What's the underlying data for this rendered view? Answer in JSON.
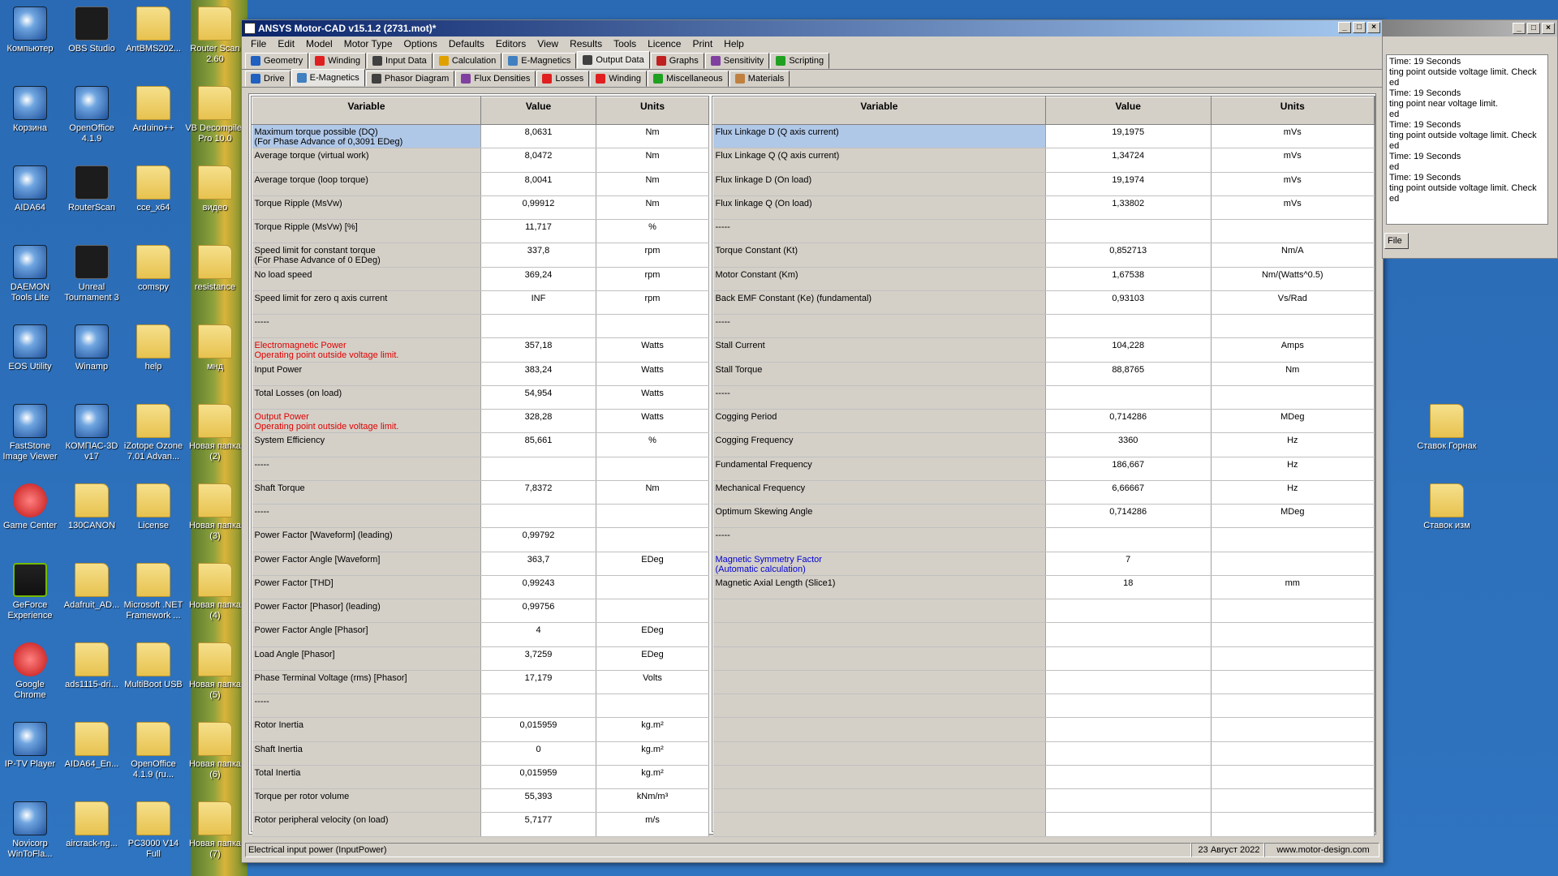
{
  "desktop": {
    "col1": [
      {
        "label": "Компьютер",
        "icon": "computer-icon"
      },
      {
        "label": "Корзина",
        "icon": "recycle-bin-icon"
      },
      {
        "label": "AIDA64",
        "icon": "aida64-icon"
      },
      {
        "label": "DAEMON Tools Lite",
        "icon": "daemon-tools-icon"
      },
      {
        "label": "EOS Utility",
        "icon": "eos-utility-icon"
      },
      {
        "label": "FastStone Image Viewer",
        "icon": "faststone-icon"
      },
      {
        "label": "Game Center",
        "icon": "game-center-icon"
      },
      {
        "label": "GeForce Experience",
        "icon": "geforce-icon"
      },
      {
        "label": "Google Chrome",
        "icon": "chrome-icon"
      },
      {
        "label": "IP-TV Player",
        "icon": "iptv-icon"
      },
      {
        "label": "Novicorp WinToFla...",
        "icon": "wintoflash-icon"
      }
    ],
    "col2": [
      {
        "label": "OBS Studio",
        "icon": "obs-icon"
      },
      {
        "label": "OpenOffice 4.1.9",
        "icon": "openoffice-icon"
      },
      {
        "label": "RouterScan",
        "icon": "routerscan-icon"
      },
      {
        "label": "Unreal Tournament 3",
        "icon": "unreal-icon"
      },
      {
        "label": "Winamp",
        "icon": "winamp-icon"
      },
      {
        "label": "КОМПАС-3D v17",
        "icon": "kompas-icon"
      },
      {
        "label": "130CANON",
        "icon": "folder-icon"
      },
      {
        "label": "Adafruit_AD...",
        "icon": "folder-icon"
      },
      {
        "label": "ads1115-dri...",
        "icon": "folder-icon"
      },
      {
        "label": "AIDA64_En...",
        "icon": "folder-icon"
      },
      {
        "label": "aircrack-ng...",
        "icon": "folder-icon"
      }
    ],
    "col3": [
      {
        "label": "AntBMS202...",
        "icon": "folder-icon"
      },
      {
        "label": "Arduino++",
        "icon": "folder-icon"
      },
      {
        "label": "cce_x64",
        "icon": "folder-icon"
      },
      {
        "label": "comspy",
        "icon": "folder-icon"
      },
      {
        "label": "help",
        "icon": "folder-icon"
      },
      {
        "label": "iZotope Ozone 7.01 Advan...",
        "icon": "folder-icon"
      },
      {
        "label": "License",
        "icon": "folder-icon"
      },
      {
        "label": "Microsoft .NET Framework ...",
        "icon": "folder-icon"
      },
      {
        "label": "MultiBoot USB",
        "icon": "folder-icon"
      },
      {
        "label": "OpenOffice 4.1.9 (ru...",
        "icon": "folder-icon"
      },
      {
        "label": "PC3000 V14 Full",
        "icon": "folder-icon"
      }
    ],
    "col4": [
      {
        "label": "Router Scan 2.60",
        "icon": "folder-icon"
      },
      {
        "label": "VB Decompiler Pro 10.0",
        "icon": "folder-icon"
      },
      {
        "label": "видео",
        "icon": "folder-icon"
      },
      {
        "label": "resistance",
        "icon": "folder-icon"
      },
      {
        "label": "мнд",
        "icon": "folder-icon"
      },
      {
        "label": "Новая папка (2)",
        "icon": "folder-icon"
      },
      {
        "label": "Новая папка (3)",
        "icon": "folder-icon"
      },
      {
        "label": "Новая папка (4)",
        "icon": "folder-icon"
      },
      {
        "label": "Новая папка (5)",
        "icon": "folder-icon"
      },
      {
        "label": "Новая папка (6)",
        "icon": "folder-icon"
      },
      {
        "label": "Новая папка (7)",
        "icon": "folder-icon"
      }
    ],
    "right": [
      {
        "label": "Ставок Горнак",
        "icon": "folder-icon"
      },
      {
        "label": "Ставок изм",
        "icon": "folder-icon"
      }
    ]
  },
  "window": {
    "title": "ANSYS Motor-CAD v15.1.2 (2731.mot)*",
    "menu": [
      "File",
      "Edit",
      "Model",
      "Motor Type",
      "Options",
      "Defaults",
      "Editors",
      "View",
      "Results",
      "Tools",
      "Licence",
      "Print",
      "Help"
    ],
    "tabs": [
      {
        "label": "Geometry",
        "color": "#2060c0"
      },
      {
        "label": "Winding",
        "color": "#e02020"
      },
      {
        "label": "Input Data",
        "color": "#404040"
      },
      {
        "label": "Calculation",
        "color": "#e0a000"
      },
      {
        "label": "E-Magnetics",
        "color": "#4080c0"
      },
      {
        "label": "Output Data",
        "color": "#404040"
      },
      {
        "label": "Graphs",
        "color": "#c02020"
      },
      {
        "label": "Sensitivity",
        "color": "#8040a0"
      },
      {
        "label": "Scripting",
        "color": "#20a020"
      }
    ],
    "subtabs": [
      {
        "label": "Drive",
        "color": "#2060c0"
      },
      {
        "label": "E-Magnetics",
        "color": "#4080c0"
      },
      {
        "label": "Phasor Diagram",
        "color": "#404040"
      },
      {
        "label": "Flux Densities",
        "color": "#8040a0"
      },
      {
        "label": "Losses",
        "color": "#e02020"
      },
      {
        "label": "Winding",
        "color": "#e02020"
      },
      {
        "label": "Miscellaneous",
        "color": "#20a020"
      },
      {
        "label": "Materials",
        "color": "#c08040"
      }
    ]
  },
  "headers": {
    "variable": "Variable",
    "value": "Value",
    "units": "Units"
  },
  "left_rows": [
    {
      "var": "Maximum torque possible (DQ)",
      "var2": "(For Phase Advance of 0,3091 EDeg)",
      "val": "8,0631",
      "unit": "Nm",
      "sel": true
    },
    {
      "var": "Average torque (virtual work)",
      "val": "8,0472",
      "unit": "Nm"
    },
    {
      "var": "Average torque (loop torque)",
      "val": "8,0041",
      "unit": "Nm"
    },
    {
      "var": "Torque Ripple (MsVw)",
      "val": "0,99912",
      "unit": "Nm"
    },
    {
      "var": "Torque Ripple (MsVw) [%]",
      "val": "11,717",
      "unit": "%"
    },
    {
      "var": "Speed limit for constant torque",
      "var2": "(For Phase Advance of 0 EDeg)",
      "val": "337,8",
      "unit": "rpm"
    },
    {
      "var": "No load speed",
      "val": "369,24",
      "unit": "rpm"
    },
    {
      "var": "Speed limit for zero q axis current",
      "val": "INF",
      "unit": "rpm"
    },
    {
      "var": "-----",
      "val": "",
      "unit": ""
    },
    {
      "var": "Electromagnetic Power",
      "var2": "Operating point outside voltage limit.",
      "val": "357,18",
      "unit": "Watts",
      "red": true
    },
    {
      "var": "Input Power",
      "val": "383,24",
      "unit": "Watts"
    },
    {
      "var": "Total Losses (on load)",
      "val": "54,954",
      "unit": "Watts"
    },
    {
      "var": "Output Power",
      "var2": "Operating point outside voltage limit.",
      "val": "328,28",
      "unit": "Watts",
      "red": true
    },
    {
      "var": "System Efficiency",
      "val": "85,661",
      "unit": "%"
    },
    {
      "var": "-----",
      "val": "",
      "unit": ""
    },
    {
      "var": "Shaft Torque",
      "val": "7,8372",
      "unit": "Nm"
    },
    {
      "var": "-----",
      "val": "",
      "unit": ""
    },
    {
      "var": "Power Factor [Waveform] (leading)",
      "val": "0,99792",
      "unit": ""
    },
    {
      "var": "Power Factor Angle [Waveform]",
      "val": "363,7",
      "unit": "EDeg"
    },
    {
      "var": "Power Factor [THD]",
      "val": "0,99243",
      "unit": ""
    },
    {
      "var": "Power Factor [Phasor] (leading)",
      "val": "0,99756",
      "unit": ""
    },
    {
      "var": "Power Factor Angle [Phasor]",
      "val": "4",
      "unit": "EDeg"
    },
    {
      "var": "Load Angle [Phasor]",
      "val": "3,7259",
      "unit": "EDeg"
    },
    {
      "var": "Phase Terminal Voltage (rms) [Phasor]",
      "val": "17,179",
      "unit": "Volts"
    },
    {
      "var": "-----",
      "val": "",
      "unit": ""
    },
    {
      "var": "Rotor Inertia",
      "val": "0,015959",
      "unit": "kg.m²"
    },
    {
      "var": "Shaft Inertia",
      "val": "0",
      "unit": "kg.m²"
    },
    {
      "var": "Total Inertia",
      "val": "0,015959",
      "unit": "kg.m²"
    },
    {
      "var": "Torque per rotor volume",
      "val": "55,393",
      "unit": "kNm/m³"
    },
    {
      "var": "Rotor peripheral velocity (on load)",
      "val": "5,7177",
      "unit": "m/s"
    }
  ],
  "right_rows": [
    {
      "var": "Flux Linkage D (Q axis current)",
      "val": "19,1975",
      "unit": "mVs",
      "sel": true
    },
    {
      "var": "Flux Linkage Q (Q axis current)",
      "val": "1,34724",
      "unit": "mVs"
    },
    {
      "var": "Flux linkage D (On load)",
      "val": "19,1974",
      "unit": "mVs"
    },
    {
      "var": "Flux linkage Q (On load)",
      "val": "1,33802",
      "unit": "mVs"
    },
    {
      "var": "-----",
      "val": "",
      "unit": ""
    },
    {
      "var": "Torque Constant (Kt)",
      "val": "0,852713",
      "unit": "Nm/A"
    },
    {
      "var": "Motor Constant (Km)",
      "val": "1,67538",
      "unit": "Nm/(Watts^0.5)"
    },
    {
      "var": "Back EMF Constant (Ke) (fundamental)",
      "val": "0,93103",
      "unit": "Vs/Rad"
    },
    {
      "var": "-----",
      "val": "",
      "unit": ""
    },
    {
      "var": "Stall Current",
      "val": "104,228",
      "unit": "Amps"
    },
    {
      "var": "Stall Torque",
      "val": "88,8765",
      "unit": "Nm"
    },
    {
      "var": "-----",
      "val": "",
      "unit": ""
    },
    {
      "var": "Cogging Period",
      "val": "0,714286",
      "unit": "MDeg"
    },
    {
      "var": "Cogging Frequency",
      "val": "3360",
      "unit": "Hz"
    },
    {
      "var": "Fundamental Frequency",
      "val": "186,667",
      "unit": "Hz"
    },
    {
      "var": "Mechanical Frequency",
      "val": "6,66667",
      "unit": "Hz"
    },
    {
      "var": "Optimum Skewing Angle",
      "val": "0,714286",
      "unit": "MDeg"
    },
    {
      "var": "-----",
      "val": "",
      "unit": ""
    },
    {
      "var": "Magnetic Symmetry Factor",
      "var2": "(Automatic calculation)",
      "val": "7",
      "unit": "",
      "blue": true
    },
    {
      "var": "Magnetic Axial Length (Slice1)",
      "val": "18",
      "unit": "mm"
    },
    {
      "var": "",
      "val": "",
      "unit": ""
    },
    {
      "var": "",
      "val": "",
      "unit": ""
    },
    {
      "var": "",
      "val": "",
      "unit": ""
    },
    {
      "var": "",
      "val": "",
      "unit": ""
    },
    {
      "var": "",
      "val": "",
      "unit": ""
    },
    {
      "var": "",
      "val": "",
      "unit": ""
    },
    {
      "var": "",
      "val": "",
      "unit": ""
    },
    {
      "var": "",
      "val": "",
      "unit": ""
    },
    {
      "var": "",
      "val": "",
      "unit": ""
    },
    {
      "var": "",
      "val": "",
      "unit": ""
    }
  ],
  "status": {
    "hint": "Electrical input power (InputPower)",
    "date": "23 Август 2022",
    "site": "www.motor-design.com"
  },
  "side_window": {
    "log": [
      "Time: 19 Seconds",
      "ting point outside voltage limit. Check",
      "ed",
      "Time: 19 Seconds",
      "ting point near voltage limit.",
      "ed",
      "Time: 19 Seconds",
      "ting point outside voltage limit. Check",
      "ed",
      "Time: 19 Seconds",
      "ed",
      "Time: 19 Seconds",
      "ting point outside voltage limit. Check",
      "ed"
    ],
    "file_btn": "File"
  }
}
